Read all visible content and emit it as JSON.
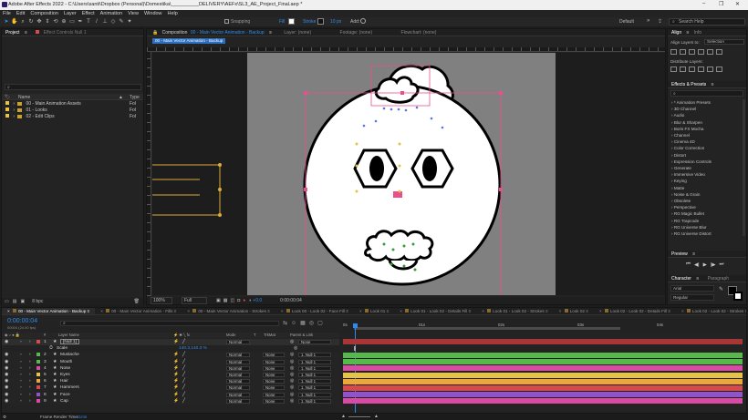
{
  "window": {
    "title": "Adobe After Effects 2022 - C:\\Users\\santi\\Dropbox (Personal)\\Domestika\\__________DELIVERY\\AEFx\\SL3_AE_Project_Final.aep *",
    "minimize": "–",
    "maximize": "❐",
    "close": "✕"
  },
  "menu": [
    "File",
    "Edit",
    "Composition",
    "Layer",
    "Effect",
    "Animation",
    "View",
    "Window",
    "Help"
  ],
  "toolbar": {
    "snapping": "Snapping",
    "fill": "Fill",
    "stroke": "Stroke",
    "stroke_width": "10 px",
    "add": "Add:",
    "workspace": "Default",
    "search_placeholder": "Search Help"
  },
  "project": {
    "tab": "Project",
    "effect_controls": "Effect Controls Null 1",
    "search_placeholder": "",
    "columns": {
      "name": "Name",
      "type": "Type"
    },
    "items": [
      {
        "name": "00 - Main Animation Assets",
        "type": "Fol"
      },
      {
        "name": "01 - Looks",
        "type": "Fol"
      },
      {
        "name": "02 - Edit Clips",
        "type": "Fol"
      }
    ],
    "bpc": "8 bpc"
  },
  "composition": {
    "tab_prefix": "Composition",
    "tab_name": "00 - Main Vector Animation - Backup",
    "breadcrumb": "00 - Main Vector Animation - Backup",
    "layer_tab": "Layer: (none)",
    "footage_tab": "Footage: (none)",
    "flowchart_tab": "Flowchart: (none)",
    "zoom": "100%",
    "resolution": "Full",
    "exposure": "+0.0",
    "timecode": "0:00:00:04"
  },
  "align": {
    "tab": "Align",
    "info_tab": "Info",
    "align_to_label": "Align Layers to:",
    "align_to_value": "Selection",
    "distribute_label": "Distribute Layers:"
  },
  "effects": {
    "tab": "Effects & Presets",
    "items": [
      "* Animation Presets",
      "3D Channel",
      "Audio",
      "Blur & Sharpen",
      "Boris FX Mocha",
      "Channel",
      "Cinema 4D",
      "Color Correction",
      "Distort",
      "Expression Controls",
      "Generate",
      "Immersive Video",
      "Keying",
      "Matte",
      "Noise & Grain",
      "Obsolete",
      "Perspective",
      "RG Magic Bullet",
      "RG Trapcode",
      "RG Universe Blur",
      "RG Universe Distort"
    ]
  },
  "preview": {
    "tab": "Preview"
  },
  "character": {
    "tab": "Character",
    "paragraph_tab": "Paragraph",
    "font": "Arial",
    "style": "Regular"
  },
  "timeline": {
    "tabs": [
      "00 - Main Vector Animation - Backup",
      "00 - Main Vector Animation - Fills",
      "00 - Main Vector Animation - Strokes",
      "Look 00 - Look 02 - Face Fill",
      "Look 01",
      "Look 01 - Look 02 - Details Fill",
      "Look 01 - Look 02 - Strokes",
      "Look 02",
      "Look 02 - Look 02 - Details Fill",
      "Look 02 - Look 02 - Strokes"
    ],
    "timecode": "0:00:00:04",
    "frame_info": "00004 (24.00 fps)",
    "col_headers": {
      "num": "#",
      "layer_name": "Layer Name",
      "mode": "Mode",
      "t": "T",
      "trkmat": "TrkMat",
      "parent": "Parent & Link"
    },
    "ruler": [
      "0s",
      "01s",
      "02s",
      "03s",
      "04s"
    ],
    "null_layer": {
      "num": "1",
      "name": "[Null 1]",
      "mode": "Normal",
      "parent": "None"
    },
    "scale": {
      "label": "Scale",
      "value": "140.3,140.3 %"
    },
    "layers": [
      {
        "num": "2",
        "name": "Mustache",
        "mode": "Normal",
        "trkmat": "None",
        "parent": "1. Null 1",
        "color": "#57b94c"
      },
      {
        "num": "3",
        "name": "Mouth",
        "mode": "Normal",
        "trkmat": "None",
        "parent": "1. Null 1",
        "color": "#57b94c"
      },
      {
        "num": "4",
        "name": "Nose",
        "mode": "Normal",
        "trkmat": "None",
        "parent": "1. Null 1",
        "color": "#d94aa4"
      },
      {
        "num": "5",
        "name": "Eyes",
        "mode": "Normal",
        "trkmat": "None",
        "parent": "1. Null 1",
        "color": "#e6c245"
      },
      {
        "num": "6",
        "name": "Hair",
        "mode": "Normal",
        "trkmat": "None",
        "parent": "1. Null 1",
        "color": "#e6a83f"
      },
      {
        "num": "7",
        "name": "Hammers",
        "mode": "Normal",
        "trkmat": "None",
        "parent": "1. Null 1",
        "color": "#d9484b"
      },
      {
        "num": "8",
        "name": "Face",
        "mode": "Normal",
        "trkmat": "None",
        "parent": "1. Null 1",
        "color": "#8e55c9"
      },
      {
        "num": "9",
        "name": "Cap",
        "mode": "Normal",
        "trkmat": "None",
        "parent": "1. Null 1",
        "color": "#d94aa4"
      }
    ]
  },
  "status": {
    "render_label": "Frame Render Time:",
    "render_value": "41ms"
  }
}
